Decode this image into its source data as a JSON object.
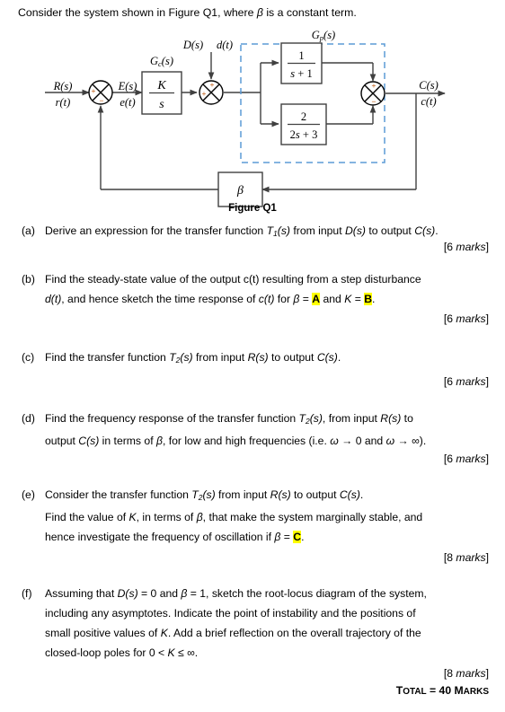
{
  "intro": "Consider the system shown in Figure Q1, where β is a constant term.",
  "figure": {
    "caption": "Figure Q1",
    "labels": {
      "input_laplace": "R(s)",
      "input_time": "r(t)",
      "error_laplace": "E(s)",
      "error_time": "e(t)",
      "disturbance_laplace": "D(s)",
      "disturbance_time": "d(t)",
      "output_laplace": "C(s)",
      "output_time": "c(t)",
      "controller_label": "Gₑ(s)",
      "plant_label": "Gₚ(s)",
      "feedback_gain": "β"
    },
    "blocks": {
      "controller": {
        "num": "K",
        "den": "s"
      },
      "plant_top": {
        "num": "1",
        "den": "s + 1"
      },
      "plant_bottom": {
        "num": "2",
        "den": "2s + 3"
      }
    },
    "signs": {
      "sum1_left": "+",
      "sum1_bottom": "−",
      "sum2_left": "+",
      "sum2_top": "+",
      "sum3_top": "+",
      "sum3_bottom": "−"
    },
    "colors": {
      "plant_dashed_border": "#5b9bd5",
      "line": "#404040",
      "sign": "#c05a10"
    }
  },
  "questions": [
    {
      "label": "(a)",
      "text": "Derive an expression for the transfer function T₁(s) from input D(s) to output C(s).",
      "marks": "[6 marks]"
    },
    {
      "label": "(b)",
      "line1": "Find the steady-state value of the output c(t) resulting from a step disturbance",
      "line2_pre": "d(t), and hence sketch the time response of c(t) for β = ",
      "line2_hl1": "A",
      "line2_mid": " and K = ",
      "line2_hl2": "B",
      "line2_post": ".",
      "marks": "[6 marks]"
    },
    {
      "label": "(c)",
      "text": "Find the transfer function T₂(s) from input R(s) to output C(s).",
      "marks": "[6 marks]"
    },
    {
      "label": "(d)",
      "line1": "Find the frequency response of the transfer function T₂(s), from input R(s) to",
      "line2": "output C(s) in terms of β, for low and high frequencies (i.e. ω → 0 and ω → ∞).",
      "marks": "[6 marks]"
    },
    {
      "label": "(e)",
      "line1": "Consider the transfer function T₂(s) from input R(s) to output C(s).",
      "line2": "Find the value of K, in terms of β, that make the system marginally stable, and",
      "line3_pre": "hence investigate the frequency of oscillation if β = ",
      "line3_hl": "C",
      "line3_post": ".",
      "marks": "[8 marks]"
    },
    {
      "label": "(f)",
      "line1": "Assuming that D(s) = 0 and β = 1, sketch the root-locus diagram of the system,",
      "line2": "including any asymptotes. Indicate the point of instability and the positions of",
      "line3": "small positive values of K. Add a brief reflection on the overall trajectory of the",
      "line4": "closed-loop poles for 0 < K ≤ ∞.",
      "marks": "[8 marks]"
    }
  ],
  "total": "TOTAL = 40 MARKS",
  "total_parts": {
    "word": "T",
    "rest": "OTAL",
    "eq": " = 40 ",
    "m": "M",
    "arks": "ARKS"
  }
}
